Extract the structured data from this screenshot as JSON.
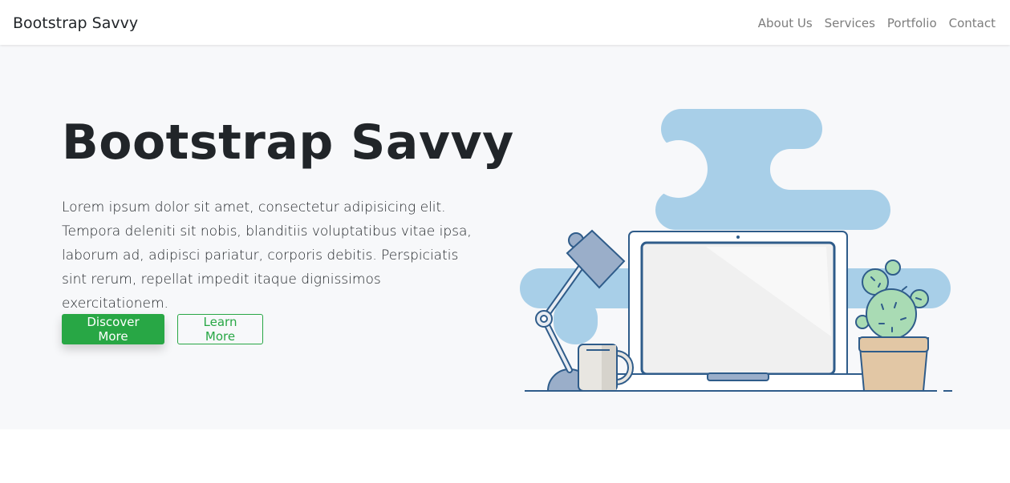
{
  "navbar": {
    "brand": "Bootstrap Savvy",
    "links": [
      "About Us",
      "Services",
      "Portfolio",
      "Contact"
    ]
  },
  "hero": {
    "title": "Bootstrap Savvy",
    "description": "Lorem ipsum dolor sit amet, consectetur adipisicing elit. Tempora deleniti sit nobis, blanditiis voluptatibus vitae ipsa, laborum ad, adipisci pariatur, corporis debitis. Perspiciatis sint rerum, repellat impedit itaque dignissimos exercitationem.",
    "primary_button": "Discover More",
    "secondary_button": "Learn More"
  },
  "colors": {
    "accent": "#28a745",
    "hero_background": "#f7f8fa",
    "cloud": "#a8cfe8",
    "outline": "#2f5c8a"
  },
  "icons": [
    "desk-lamp-icon",
    "laptop-icon",
    "coffee-mug-icon",
    "cactus-plant-icon"
  ]
}
